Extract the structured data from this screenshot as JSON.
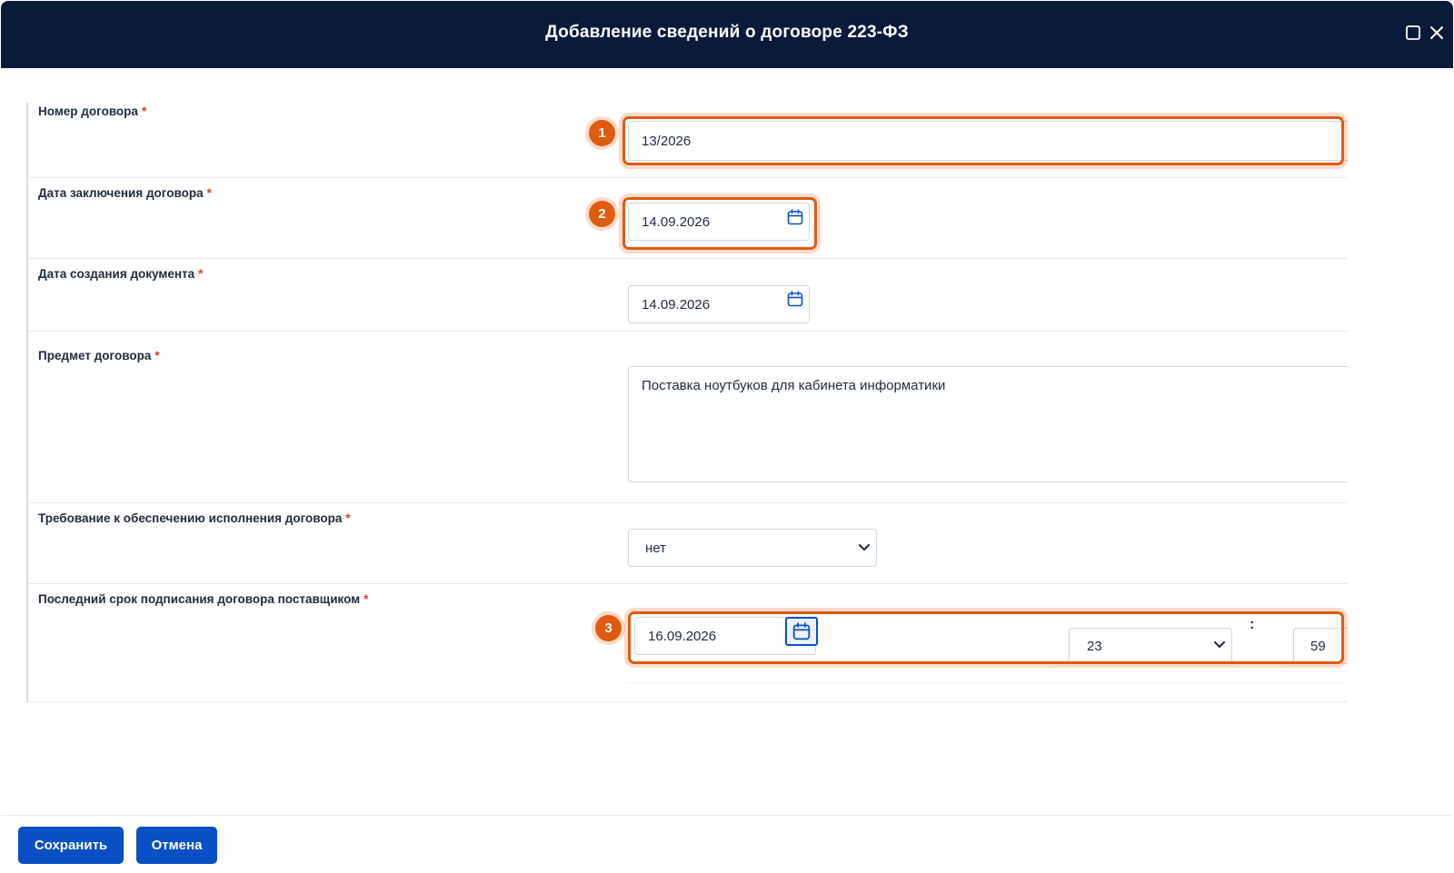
{
  "dialog": {
    "title": "Добавление сведений о договоре 223-ФЗ"
  },
  "fields": {
    "contract_number": {
      "label": "Номер договора",
      "required": "*",
      "value": "13/2026"
    },
    "conclusion_date": {
      "label": "Дата заключения договора",
      "required": "*",
      "value": "14.09.2026"
    },
    "creation_date": {
      "label": "Дата создания документа",
      "required": "*",
      "value": "14.09.2026"
    },
    "subject": {
      "label": "Предмет договора",
      "required": "*",
      "value": "Поставка ноутбуков для кабинета информатики"
    },
    "security_requirement": {
      "label": "Требование к обеспечению исполнения договора",
      "required": "*",
      "value": "нет"
    },
    "signing_deadline": {
      "label": "Последний срок подписания договора поставщиком",
      "required": "*",
      "date": "16.09.2026",
      "hour": "23",
      "separator": ":",
      "minute": "59"
    }
  },
  "annotations": {
    "badge1": "1",
    "badge2": "2",
    "badge3": "3"
  },
  "footer": {
    "save_label": "Сохранить",
    "cancel_label": "Отмена"
  },
  "icons": {
    "calendar": "calendar-icon",
    "maximize": "maximize-icon",
    "close": "close-icon",
    "chevron": "chevron-down-icon"
  },
  "colors": {
    "header_bg": "#0c1a3a",
    "accent": "#0a4fc4",
    "highlight": "#e05a12",
    "required": "#d23b2e"
  }
}
